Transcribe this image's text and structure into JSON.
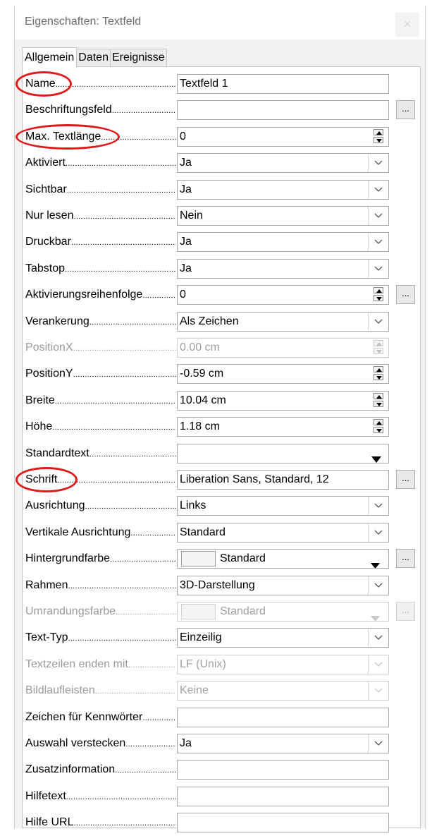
{
  "dialog": {
    "title": "Eigenschaften: Textfeld",
    "close_label": "×"
  },
  "tabs": [
    {
      "label": "Allgemein",
      "active": true
    },
    {
      "label": "Daten",
      "active": false
    },
    {
      "label": "Ereignisse",
      "active": false
    }
  ],
  "properties": [
    {
      "label": "Name",
      "value": "Textfeld 1",
      "control": "text",
      "enabled": true,
      "highlighted": true
    },
    {
      "label": "Beschriftungsfeld",
      "value": "",
      "control": "text",
      "enabled": true,
      "button": "..."
    },
    {
      "label": "Max. Textlänge",
      "value": "0",
      "control": "spin",
      "enabled": true,
      "highlighted": true
    },
    {
      "label": "Aktiviert",
      "value": "Ja",
      "control": "dropdown",
      "enabled": true
    },
    {
      "label": "Sichtbar",
      "value": "Ja",
      "control": "dropdown",
      "enabled": true
    },
    {
      "label": "Nur lesen",
      "value": "Nein",
      "control": "dropdown",
      "enabled": true
    },
    {
      "label": "Druckbar",
      "value": "Ja",
      "control": "dropdown",
      "enabled": true
    },
    {
      "label": "Tabstop",
      "value": "Ja",
      "control": "dropdown",
      "enabled": true
    },
    {
      "label": "Aktivierungsreihenfolge",
      "value": "0",
      "control": "spin",
      "enabled": true,
      "button": "..."
    },
    {
      "label": "Verankerung",
      "value": "Als Zeichen",
      "control": "dropdown",
      "enabled": true
    },
    {
      "label": "PositionX",
      "value": "0.00 cm",
      "control": "spin",
      "enabled": false
    },
    {
      "label": "PositionY",
      "value": "-0.59 cm",
      "control": "spin",
      "enabled": true
    },
    {
      "label": "Breite",
      "value": "10.04 cm",
      "control": "spin",
      "enabled": true
    },
    {
      "label": "Höhe",
      "value": "1.18 cm",
      "control": "spin",
      "enabled": true
    },
    {
      "label": "Standardtext",
      "value": "",
      "control": "combo",
      "enabled": true
    },
    {
      "label": "Schrift",
      "value": "Liberation Sans, Standard, 12",
      "control": "text",
      "enabled": true,
      "button": "...",
      "highlighted": true
    },
    {
      "label": "Ausrichtung",
      "value": "Links",
      "control": "dropdown",
      "enabled": true
    },
    {
      "label": "Vertikale Ausrichtung",
      "value": "Standard",
      "control": "dropdown",
      "enabled": true
    },
    {
      "label": "Hintergrundfarbe",
      "value": "Standard",
      "control": "color",
      "enabled": true,
      "button": "..."
    },
    {
      "label": "Rahmen",
      "value": "3D-Darstellung",
      "control": "dropdown",
      "enabled": true
    },
    {
      "label": "Umrandungsfarbe",
      "value": "Standard",
      "control": "color",
      "enabled": false,
      "button": "..."
    },
    {
      "label": "Text-Typ",
      "value": "Einzeilig",
      "control": "dropdown",
      "enabled": true
    },
    {
      "label": "Textzeilen enden mit",
      "value": "LF (Unix)",
      "control": "dropdown",
      "enabled": false
    },
    {
      "label": "Bildlaufleisten",
      "value": "Keine",
      "control": "dropdown",
      "enabled": false
    },
    {
      "label": "Zeichen für Kennwörter",
      "value": "",
      "control": "text",
      "enabled": true
    },
    {
      "label": "Auswahl verstecken",
      "value": "Ja",
      "control": "dropdown",
      "enabled": true
    },
    {
      "label": "Zusatzinformation",
      "value": "",
      "control": "text",
      "enabled": true
    },
    {
      "label": "Hilfetext",
      "value": "",
      "control": "text",
      "enabled": true
    },
    {
      "label": "Hilfe URL",
      "value": "",
      "control": "text",
      "enabled": true
    }
  ],
  "colors": {
    "highlight_circle": "#e01a1a",
    "disabled_text": "#9a9a9a"
  }
}
